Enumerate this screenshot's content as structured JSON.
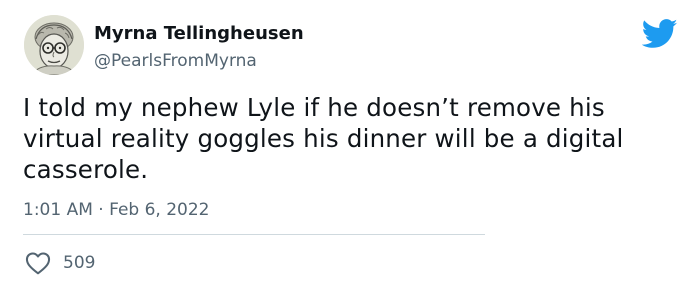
{
  "author": {
    "name": "Myrna Tellingheusen",
    "handle": "@PearlsFromMyrna"
  },
  "tweet": {
    "text": "I told my nephew Lyle if he doesn’t remove his virtual reality goggles his dinner will be a digital casserole.",
    "time": "1:01 AM",
    "separator": "·",
    "date": "Feb 6, 2022"
  },
  "actions": {
    "like_count": "509"
  },
  "icons": {
    "brand": "twitter-bird-icon",
    "like": "heart-icon"
  },
  "colors": {
    "brand_blue": "#1d9bf0",
    "text_primary": "#0f1419",
    "text_secondary": "#536471",
    "divider": "#cfd9de"
  }
}
